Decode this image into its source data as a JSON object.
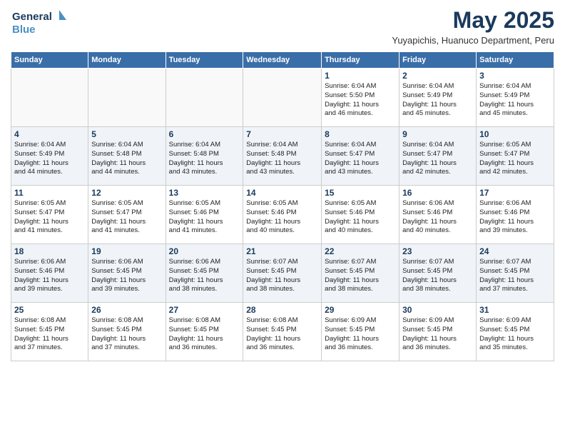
{
  "header": {
    "logo_general": "General",
    "logo_blue": "Blue",
    "month_title": "May 2025",
    "location": "Yuyapichis, Huanuco Department, Peru"
  },
  "days_of_week": [
    "Sunday",
    "Monday",
    "Tuesday",
    "Wednesday",
    "Thursday",
    "Friday",
    "Saturday"
  ],
  "weeks": [
    [
      {
        "day": "",
        "info": ""
      },
      {
        "day": "",
        "info": ""
      },
      {
        "day": "",
        "info": ""
      },
      {
        "day": "",
        "info": ""
      },
      {
        "day": "1",
        "info": "Sunrise: 6:04 AM\nSunset: 5:50 PM\nDaylight: 11 hours\nand 46 minutes."
      },
      {
        "day": "2",
        "info": "Sunrise: 6:04 AM\nSunset: 5:49 PM\nDaylight: 11 hours\nand 45 minutes."
      },
      {
        "day": "3",
        "info": "Sunrise: 6:04 AM\nSunset: 5:49 PM\nDaylight: 11 hours\nand 45 minutes."
      }
    ],
    [
      {
        "day": "4",
        "info": "Sunrise: 6:04 AM\nSunset: 5:49 PM\nDaylight: 11 hours\nand 44 minutes."
      },
      {
        "day": "5",
        "info": "Sunrise: 6:04 AM\nSunset: 5:48 PM\nDaylight: 11 hours\nand 44 minutes."
      },
      {
        "day": "6",
        "info": "Sunrise: 6:04 AM\nSunset: 5:48 PM\nDaylight: 11 hours\nand 43 minutes."
      },
      {
        "day": "7",
        "info": "Sunrise: 6:04 AM\nSunset: 5:48 PM\nDaylight: 11 hours\nand 43 minutes."
      },
      {
        "day": "8",
        "info": "Sunrise: 6:04 AM\nSunset: 5:47 PM\nDaylight: 11 hours\nand 43 minutes."
      },
      {
        "day": "9",
        "info": "Sunrise: 6:04 AM\nSunset: 5:47 PM\nDaylight: 11 hours\nand 42 minutes."
      },
      {
        "day": "10",
        "info": "Sunrise: 6:05 AM\nSunset: 5:47 PM\nDaylight: 11 hours\nand 42 minutes."
      }
    ],
    [
      {
        "day": "11",
        "info": "Sunrise: 6:05 AM\nSunset: 5:47 PM\nDaylight: 11 hours\nand 41 minutes."
      },
      {
        "day": "12",
        "info": "Sunrise: 6:05 AM\nSunset: 5:47 PM\nDaylight: 11 hours\nand 41 minutes."
      },
      {
        "day": "13",
        "info": "Sunrise: 6:05 AM\nSunset: 5:46 PM\nDaylight: 11 hours\nand 41 minutes."
      },
      {
        "day": "14",
        "info": "Sunrise: 6:05 AM\nSunset: 5:46 PM\nDaylight: 11 hours\nand 40 minutes."
      },
      {
        "day": "15",
        "info": "Sunrise: 6:05 AM\nSunset: 5:46 PM\nDaylight: 11 hours\nand 40 minutes."
      },
      {
        "day": "16",
        "info": "Sunrise: 6:06 AM\nSunset: 5:46 PM\nDaylight: 11 hours\nand 40 minutes."
      },
      {
        "day": "17",
        "info": "Sunrise: 6:06 AM\nSunset: 5:46 PM\nDaylight: 11 hours\nand 39 minutes."
      }
    ],
    [
      {
        "day": "18",
        "info": "Sunrise: 6:06 AM\nSunset: 5:46 PM\nDaylight: 11 hours\nand 39 minutes."
      },
      {
        "day": "19",
        "info": "Sunrise: 6:06 AM\nSunset: 5:45 PM\nDaylight: 11 hours\nand 39 minutes."
      },
      {
        "day": "20",
        "info": "Sunrise: 6:06 AM\nSunset: 5:45 PM\nDaylight: 11 hours\nand 38 minutes."
      },
      {
        "day": "21",
        "info": "Sunrise: 6:07 AM\nSunset: 5:45 PM\nDaylight: 11 hours\nand 38 minutes."
      },
      {
        "day": "22",
        "info": "Sunrise: 6:07 AM\nSunset: 5:45 PM\nDaylight: 11 hours\nand 38 minutes."
      },
      {
        "day": "23",
        "info": "Sunrise: 6:07 AM\nSunset: 5:45 PM\nDaylight: 11 hours\nand 38 minutes."
      },
      {
        "day": "24",
        "info": "Sunrise: 6:07 AM\nSunset: 5:45 PM\nDaylight: 11 hours\nand 37 minutes."
      }
    ],
    [
      {
        "day": "25",
        "info": "Sunrise: 6:08 AM\nSunset: 5:45 PM\nDaylight: 11 hours\nand 37 minutes."
      },
      {
        "day": "26",
        "info": "Sunrise: 6:08 AM\nSunset: 5:45 PM\nDaylight: 11 hours\nand 37 minutes."
      },
      {
        "day": "27",
        "info": "Sunrise: 6:08 AM\nSunset: 5:45 PM\nDaylight: 11 hours\nand 36 minutes."
      },
      {
        "day": "28",
        "info": "Sunrise: 6:08 AM\nSunset: 5:45 PM\nDaylight: 11 hours\nand 36 minutes."
      },
      {
        "day": "29",
        "info": "Sunrise: 6:09 AM\nSunset: 5:45 PM\nDaylight: 11 hours\nand 36 minutes."
      },
      {
        "day": "30",
        "info": "Sunrise: 6:09 AM\nSunset: 5:45 PM\nDaylight: 11 hours\nand 36 minutes."
      },
      {
        "day": "31",
        "info": "Sunrise: 6:09 AM\nSunset: 5:45 PM\nDaylight: 11 hours\nand 35 minutes."
      }
    ]
  ]
}
